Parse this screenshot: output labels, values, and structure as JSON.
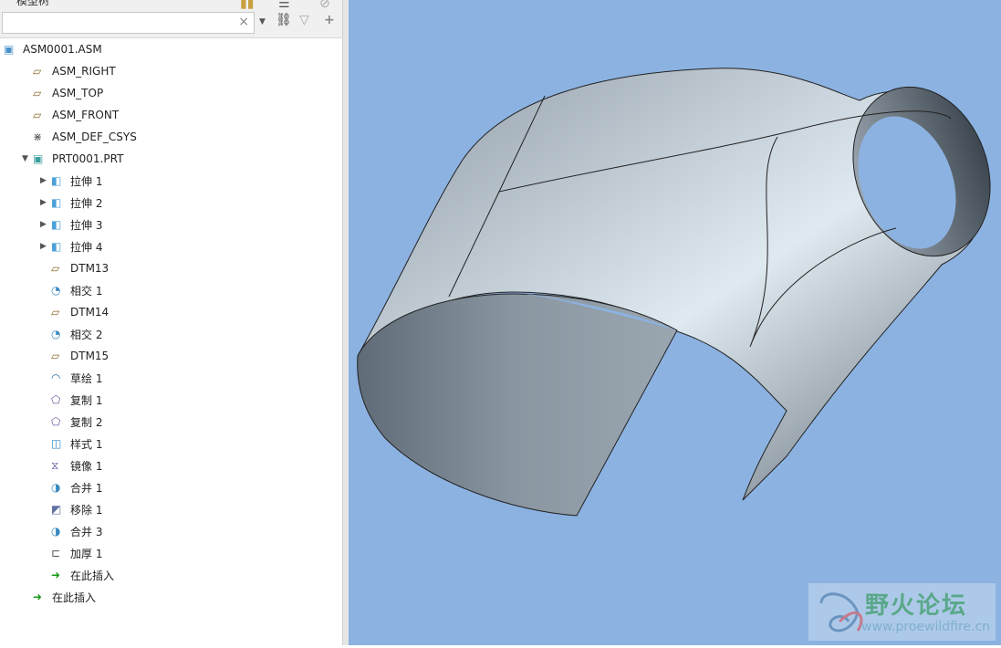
{
  "panel": {
    "title": "模型树",
    "search": {
      "value": "",
      "placeholder": ""
    }
  },
  "tree": [
    {
      "label": "ASM0001.ASM",
      "icon": "assembly-icon",
      "level": 0,
      "expand": ""
    },
    {
      "label": "ASM_RIGHT",
      "icon": "datum-plane-icon",
      "level": 1,
      "expand": ""
    },
    {
      "label": "ASM_TOP",
      "icon": "datum-plane-icon",
      "level": 1,
      "expand": ""
    },
    {
      "label": "ASM_FRONT",
      "icon": "datum-plane-icon",
      "level": 1,
      "expand": ""
    },
    {
      "label": "ASM_DEF_CSYS",
      "icon": "csys-icon",
      "level": 1,
      "expand": ""
    },
    {
      "label": "PRT0001.PRT",
      "icon": "part-icon",
      "level": 1,
      "expand": "▼"
    },
    {
      "label": "拉伸 1",
      "icon": "extrude-icon",
      "level": 2,
      "expand": "▶"
    },
    {
      "label": "拉伸 2",
      "icon": "extrude-icon",
      "level": 2,
      "expand": "▶"
    },
    {
      "label": "拉伸 3",
      "icon": "extrude-icon",
      "level": 2,
      "expand": "▶"
    },
    {
      "label": "拉伸 4",
      "icon": "extrude-icon",
      "level": 2,
      "expand": "▶"
    },
    {
      "label": "DTM13",
      "icon": "datum-plane-icon",
      "level": 2,
      "expand": ""
    },
    {
      "label": "相交 1",
      "icon": "intersect-icon",
      "level": 2,
      "expand": ""
    },
    {
      "label": "DTM14",
      "icon": "datum-plane-icon",
      "level": 2,
      "expand": ""
    },
    {
      "label": "相交 2",
      "icon": "intersect-icon",
      "level": 2,
      "expand": ""
    },
    {
      "label": "DTM15",
      "icon": "datum-plane-icon",
      "level": 2,
      "expand": ""
    },
    {
      "label": "草绘 1",
      "icon": "sketch-icon",
      "level": 2,
      "expand": ""
    },
    {
      "label": "复制 1",
      "icon": "copy-icon",
      "level": 2,
      "expand": ""
    },
    {
      "label": "复制 2",
      "icon": "copy-icon",
      "level": 2,
      "expand": ""
    },
    {
      "label": "样式 1",
      "icon": "style-icon",
      "level": 2,
      "expand": ""
    },
    {
      "label": "镜像 1",
      "icon": "mirror-icon",
      "level": 2,
      "expand": ""
    },
    {
      "label": "合并 1",
      "icon": "merge-icon",
      "level": 2,
      "expand": ""
    },
    {
      "label": "移除 1",
      "icon": "remove-icon",
      "level": 2,
      "expand": ""
    },
    {
      "label": "合并 3",
      "icon": "merge-icon",
      "level": 2,
      "expand": ""
    },
    {
      "label": "加厚 1",
      "icon": "thicken-icon",
      "level": 2,
      "expand": ""
    },
    {
      "label": "在此插入",
      "icon": "insert-here-icon",
      "level": 2,
      "expand": ""
    },
    {
      "label": "在此插入",
      "icon": "insert-here-icon",
      "level": 1,
      "expand": ""
    }
  ],
  "watermark": {
    "title": "野火论坛",
    "url": "www.proewildfire.cn"
  }
}
